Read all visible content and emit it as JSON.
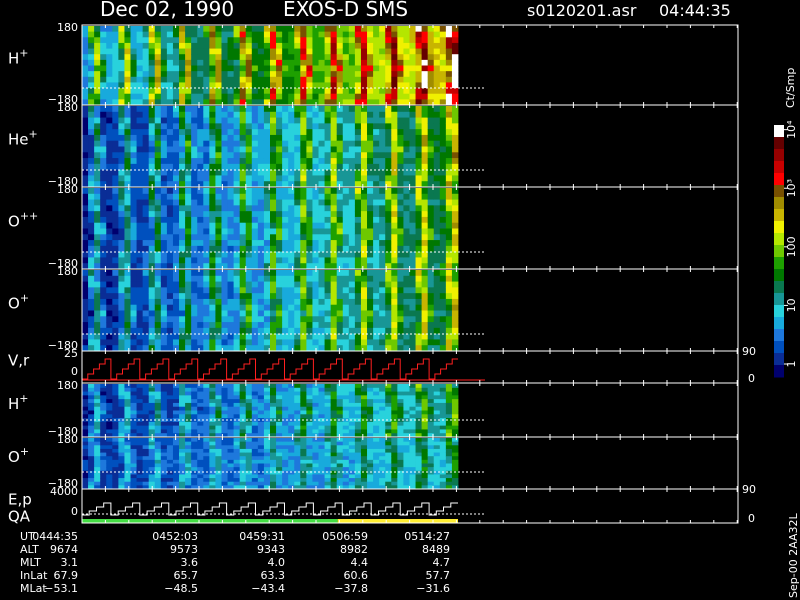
{
  "header": {
    "date": "Dec 02, 1990",
    "mission": "EXOS-D SMS",
    "file": "s0120201.asr",
    "time": "04:44:35"
  },
  "colorbar": {
    "unit_label": "Ct/Smp",
    "scale": "log",
    "range": [
      0.6,
      12000
    ],
    "colors": [
      "#00006e",
      "#0a2d96",
      "#0050be",
      "#1e78dc",
      "#18aadc",
      "#28d2dc",
      "#189696",
      "#0a7850",
      "#007800",
      "#1ea000",
      "#6ec800",
      "#b4e600",
      "#f0f000",
      "#c8b400",
      "#a08c00",
      "#785000",
      "#ff0000",
      "#c80000",
      "#960000",
      "#640000",
      "#ffffff"
    ],
    "ticks": [
      {
        "value": 1,
        "label": "1"
      },
      {
        "value": 10,
        "label": "10"
      },
      {
        "value": 100,
        "label": "100"
      },
      {
        "value": 1000,
        "label": "10³"
      },
      {
        "value": 10000,
        "label": "10⁴"
      }
    ]
  },
  "chart_data": {
    "type": "heatmap",
    "title": "Dec 02, 1990   EXOS-D SMS",
    "time_range": [
      "04:44:35",
      "05:14:27"
    ],
    "time_ticks": [
      "0444:35",
      "0452:03",
      "0459:31",
      "0506:59",
      "0514:27"
    ],
    "panels": [
      {
        "label": "H",
        "sup": "+",
        "type": "heatmap",
        "ylim": [
          -180,
          180
        ],
        "tick_labels": [
          "180",
          "−180"
        ],
        "peak_log": 3.3,
        "base_log": 0.6
      },
      {
        "label": "He",
        "sup": "+",
        "type": "heatmap",
        "ylim": [
          -180,
          180
        ],
        "tick_labels": [
          "180",
          "−180"
        ],
        "peak_log": 2.1,
        "base_log": 0.0
      },
      {
        "label": "O",
        "sup": "++",
        "type": "heatmap",
        "ylim": [
          -180,
          180
        ],
        "tick_labels": [
          "180",
          "−180"
        ],
        "peak_log": 2.0,
        "base_log": 0.0
      },
      {
        "label": "O",
        "sup": "+",
        "type": "heatmap",
        "ylim": [
          -180,
          180
        ],
        "tick_labels": [
          "180",
          "−180"
        ],
        "peak_log": 2.0,
        "base_log": 0.0
      },
      {
        "label": "V,r",
        "type": "line",
        "ylim": [
          0,
          25
        ],
        "tick_labels": [
          "25",
          "0"
        ],
        "right_labels": [
          "90",
          "0"
        ]
      },
      {
        "label": "H",
        "sup": "+",
        "type": "heatmap",
        "ylim": [
          -180,
          180
        ],
        "tick_labels": [
          "180",
          "−180"
        ],
        "peak_log": 1.6,
        "base_log": 0.0
      },
      {
        "label": "O",
        "sup": "+",
        "type": "heatmap",
        "ylim": [
          -180,
          180
        ],
        "tick_labels": [
          "180",
          "−180"
        ],
        "peak_log": 1.3,
        "base_log": 0.1
      },
      {
        "label": "E,p",
        "label2": "QA",
        "type": "line",
        "ylim": [
          0,
          4000
        ],
        "tick_labels": [
          "4000",
          "0"
        ],
        "right_labels": [
          "90",
          "0"
        ]
      }
    ],
    "ephemeris": {
      "rows": [
        {
          "name": "UT",
          "values": [
            "0444:35",
            "0452:03",
            "0459:31",
            "0506:59",
            "0514:27"
          ]
        },
        {
          "name": "ALT",
          "values": [
            "9674",
            "9573",
            "9343",
            "8982",
            "8489"
          ]
        },
        {
          "name": "MLT",
          "values": [
            "3.1",
            "3.6",
            "4.0",
            "4.4",
            "4.7"
          ]
        },
        {
          "name": "InLat",
          "values": [
            "67.9",
            "65.7",
            "63.3",
            "60.6",
            "57.7"
          ]
        },
        {
          "name": "MLat",
          "values": [
            "−53.1",
            "−48.5",
            "−43.4",
            "−37.8",
            "−31.6"
          ]
        }
      ]
    },
    "qa_bar": [
      {
        "until_fraction": 0.68,
        "color": "#44dd44"
      },
      {
        "until_fraction": 1.0,
        "color": "#ffee33"
      }
    ],
    "data_fraction_of_time_axis": 0.57
  },
  "footer": {
    "code": "Sep-00 2AA32L"
  }
}
